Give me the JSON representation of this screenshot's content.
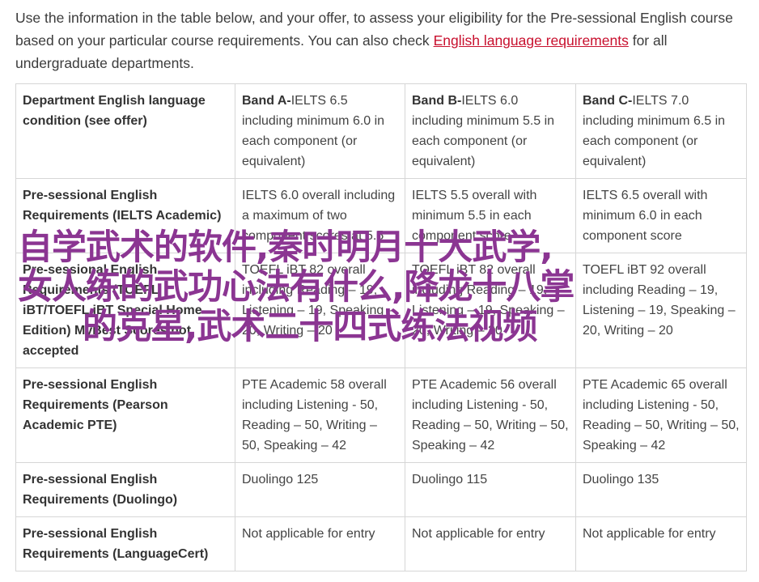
{
  "intro": {
    "text_before": "Use the information in the table below, and your offer, to assess your eligibility for the Pre-sessional English course based on your particular course requirements. You can also check ",
    "link": "English language requirements",
    "text_after": " for all undergraduate departments."
  },
  "table": {
    "header": {
      "label": "Department English language condition (see offer)",
      "bands": [
        {
          "name": "Band A-",
          "text": "IELTS 6.5 including minimum 6.0 in each component (or equivalent)"
        },
        {
          "name": "Band B-",
          "text": "IELTS 6.0 including minimum 5.5 in each component (or equivalent)"
        },
        {
          "name": "Band C-",
          "text": "IELTS 7.0 including minimum 6.5 in each component (or equivalent)"
        }
      ]
    },
    "rows": [
      {
        "label": "Pre-sessional English Requirements (IELTS Academic)",
        "cells": [
          "IELTS 6.0 overall including a maximum of two component scores at 5.5",
          "IELTS 5.5 overall with minimum 5.5 in each component score",
          "IELTS 6.5 overall with minimum 6.0 in each component score"
        ]
      },
      {
        "label": "Pre-sessional English Requirements (TOEFL iBT/TOEFL iBT Special Home Edition) MyBest Scores not accepted",
        "cells": [
          "TOEFL iBT 82 overall including Reading – 19, Listening – 19, Speaking – 20, Writing – 20",
          "TOEFL iBT 82 overall including Reading – 19, Listening – 19, Speaking – 20, Writing – 20",
          "TOEFL iBT 92 overall including Reading – 19, Listening – 19, Speaking – 20, Writing – 20"
        ]
      },
      {
        "label": "Pre-sessional English Requirements (Pearson Academic PTE)",
        "cells": [
          "PTE Academic 58 overall including Listening - 50, Reading – 50, Writing – 50, Speaking – 42",
          "PTE Academic 56 overall including Listening - 50, Reading – 50, Writing – 50, Speaking – 42",
          "PTE Academic 65 overall including Listening - 50, Reading – 50, Writing – 50, Speaking – 42"
        ]
      },
      {
        "label": "Pre-sessional English Requirements (Duolingo)",
        "cells": [
          "Duolingo 125",
          "Duolingo 115",
          "Duolingo 135"
        ]
      },
      {
        "label": "Pre-sessional English Requirements (LanguageCert)",
        "cells": [
          "Not applicable for entry",
          "Not applicable for entry",
          "Not applicable for entry"
        ]
      }
    ]
  },
  "overlay": {
    "line1": "自学武术的软件,秦时明月十大武学,",
    "line2": "女人练的武功心法有什么,降龙十八掌",
    "line3": "的克星,武术二十四式练法视频"
  },
  "colors": {
    "link": "#c8102e",
    "overlay_text": "#8b3592",
    "border": "#d6d6d6"
  }
}
